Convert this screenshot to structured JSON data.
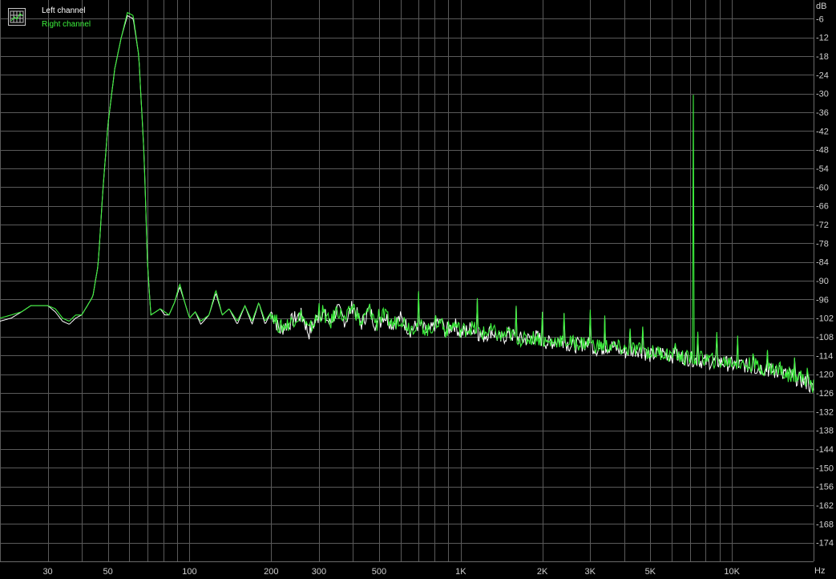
{
  "chart_data": {
    "type": "line",
    "xscale": "log",
    "xlim": [
      20,
      20000
    ],
    "ylim": [
      -180,
      0
    ],
    "xlabel": "Hz",
    "ylabel": "dB",
    "grid": true,
    "legend_placement": "top-left",
    "x_ticks": [
      {
        "value": 30,
        "label": "30"
      },
      {
        "value": 50,
        "label": "50"
      },
      {
        "value": 100,
        "label": "100"
      },
      {
        "value": 200,
        "label": "200"
      },
      {
        "value": 300,
        "label": "300"
      },
      {
        "value": 500,
        "label": "500"
      },
      {
        "value": 1000,
        "label": "1K"
      },
      {
        "value": 2000,
        "label": "2K"
      },
      {
        "value": 3000,
        "label": "3K"
      },
      {
        "value": 5000,
        "label": "5K"
      },
      {
        "value": 10000,
        "label": "10K"
      }
    ],
    "y_ticks": [
      -6,
      -12,
      -18,
      -24,
      -30,
      -36,
      -42,
      -48,
      -54,
      -60,
      -66,
      -72,
      -78,
      -84,
      -90,
      -96,
      -102,
      -108,
      -114,
      -120,
      -126,
      -132,
      -138,
      -144,
      -150,
      -156,
      -162,
      -168,
      -174
    ],
    "y_tick_labels": [
      "-6",
      "-12",
      "-18",
      "-24",
      "-30",
      "-36",
      "-42",
      "-48",
      "-54",
      "-60",
      "-66",
      "-72",
      "-78",
      "-84",
      "-90",
      "-96",
      "-102",
      "-108",
      "-114",
      "-120",
      "-126",
      "-132",
      "-138",
      "-144",
      "-150",
      "-156",
      "-162",
      "-168",
      "-174"
    ],
    "series": [
      {
        "name": "Left channel",
        "color": "#ffffff",
        "points": [
          [
            20,
            -103
          ],
          [
            22,
            -102
          ],
          [
            24,
            -100
          ],
          [
            26,
            -98
          ],
          [
            28,
            -98
          ],
          [
            30,
            -98
          ],
          [
            32,
            -100
          ],
          [
            34,
            -103
          ],
          [
            36,
            -104
          ],
          [
            38,
            -102
          ],
          [
            40,
            -101
          ],
          [
            42,
            -98
          ],
          [
            44,
            -95
          ],
          [
            46,
            -85
          ],
          [
            48,
            -60
          ],
          [
            50,
            -40
          ],
          [
            53,
            -22
          ],
          [
            56,
            -12
          ],
          [
            59,
            -5
          ],
          [
            62,
            -6
          ],
          [
            65,
            -18
          ],
          [
            68,
            -50
          ],
          [
            70,
            -85
          ],
          [
            72,
            -101
          ],
          [
            75,
            -100
          ],
          [
            78,
            -99
          ],
          [
            81,
            -101
          ],
          [
            84,
            -101
          ],
          [
            88,
            -97
          ],
          [
            92,
            -92
          ],
          [
            96,
            -97
          ],
          [
            100,
            -102
          ],
          [
            105,
            -100
          ],
          [
            110,
            -104
          ],
          [
            118,
            -101
          ],
          [
            125,
            -94
          ],
          [
            132,
            -101
          ],
          [
            140,
            -99
          ],
          [
            150,
            -104
          ],
          [
            160,
            -98
          ],
          [
            170,
            -104
          ],
          [
            180,
            -97
          ],
          [
            190,
            -104
          ],
          [
            200,
            -100
          ],
          [
            215,
            -106
          ],
          [
            230,
            -104
          ],
          [
            245,
            -102
          ],
          [
            260,
            -101
          ],
          [
            275,
            -107
          ],
          [
            290,
            -103
          ],
          [
            310,
            -100
          ],
          [
            330,
            -104
          ],
          [
            350,
            -99
          ],
          [
            375,
            -103
          ],
          [
            400,
            -98
          ],
          [
            430,
            -104
          ],
          [
            460,
            -99
          ],
          [
            490,
            -105
          ],
          [
            520,
            -101
          ],
          [
            560,
            -104
          ],
          [
            600,
            -102
          ],
          [
            650,
            -106
          ],
          [
            700,
            -104
          ],
          [
            760,
            -107
          ],
          [
            820,
            -103
          ],
          [
            880,
            -106
          ],
          [
            950,
            -104
          ],
          [
            1000,
            -107
          ],
          [
            1100,
            -105
          ],
          [
            1200,
            -108
          ],
          [
            1300,
            -106
          ],
          [
            1400,
            -109
          ],
          [
            1500,
            -107
          ],
          [
            1700,
            -109
          ],
          [
            1900,
            -108
          ],
          [
            2100,
            -110
          ],
          [
            2300,
            -109
          ],
          [
            2600,
            -111
          ],
          [
            2900,
            -110
          ],
          [
            3200,
            -112
          ],
          [
            3600,
            -111
          ],
          [
            4000,
            -113
          ],
          [
            4500,
            -112
          ],
          [
            5000,
            -114
          ],
          [
            5500,
            -113
          ],
          [
            6000,
            -114
          ],
          [
            7000,
            -115
          ],
          [
            8000,
            -116
          ],
          [
            9000,
            -116
          ],
          [
            10000,
            -117
          ],
          [
            11000,
            -117
          ],
          [
            12000,
            -118
          ],
          [
            13000,
            -118
          ],
          [
            14000,
            -119
          ],
          [
            15000,
            -120
          ],
          [
            16000,
            -120
          ],
          [
            17000,
            -121
          ],
          [
            18000,
            -122
          ],
          [
            19000,
            -123
          ],
          [
            20000,
            -125
          ]
        ],
        "spikes": [
          [
            300,
            -97
          ],
          [
            500,
            -95
          ],
          [
            700,
            -90
          ],
          [
            850,
            -98
          ],
          [
            1150,
            -94
          ],
          [
            1600,
            -97
          ],
          [
            2000,
            -100
          ],
          [
            2400,
            -96
          ],
          [
            3000,
            -97
          ],
          [
            3400,
            -99
          ],
          [
            4200,
            -100
          ],
          [
            4700,
            -99
          ],
          [
            6200,
            -106
          ],
          [
            7500,
            -104
          ],
          [
            8800,
            -107
          ],
          [
            10500,
            -108
          ],
          [
            12000,
            -109
          ],
          [
            13500,
            -110
          ],
          [
            15000,
            -112
          ],
          [
            17000,
            -113
          ],
          [
            19000,
            -115
          ]
        ]
      },
      {
        "name": "Right channel",
        "color": "#3cf03c",
        "points": [
          [
            20,
            -102
          ],
          [
            22,
            -101
          ],
          [
            24,
            -100
          ],
          [
            26,
            -98
          ],
          [
            28,
            -98
          ],
          [
            30,
            -98
          ],
          [
            32,
            -99
          ],
          [
            34,
            -102
          ],
          [
            36,
            -103
          ],
          [
            38,
            -101
          ],
          [
            40,
            -101
          ],
          [
            42,
            -98
          ],
          [
            44,
            -95
          ],
          [
            46,
            -85
          ],
          [
            48,
            -60
          ],
          [
            50,
            -40
          ],
          [
            53,
            -22
          ],
          [
            56,
            -12
          ],
          [
            59,
            -4
          ],
          [
            62,
            -5
          ],
          [
            65,
            -18
          ],
          [
            68,
            -50
          ],
          [
            70,
            -85
          ],
          [
            72,
            -101
          ],
          [
            75,
            -100
          ],
          [
            78,
            -99
          ],
          [
            81,
            -100
          ],
          [
            84,
            -101
          ],
          [
            88,
            -97
          ],
          [
            92,
            -91
          ],
          [
            96,
            -97
          ],
          [
            100,
            -102
          ],
          [
            105,
            -100
          ],
          [
            110,
            -103
          ],
          [
            118,
            -101
          ],
          [
            125,
            -93
          ],
          [
            132,
            -101
          ],
          [
            140,
            -99
          ],
          [
            150,
            -103
          ],
          [
            160,
            -98
          ],
          [
            170,
            -103
          ],
          [
            180,
            -97
          ],
          [
            190,
            -103
          ],
          [
            200,
            -100
          ],
          [
            215,
            -105
          ],
          [
            230,
            -104
          ],
          [
            245,
            -102
          ],
          [
            260,
            -101
          ],
          [
            275,
            -106
          ],
          [
            290,
            -103
          ],
          [
            310,
            -100
          ],
          [
            330,
            -104
          ],
          [
            350,
            -99
          ],
          [
            375,
            -103
          ],
          [
            400,
            -98
          ],
          [
            430,
            -104
          ],
          [
            460,
            -99
          ],
          [
            490,
            -104
          ],
          [
            520,
            -101
          ],
          [
            560,
            -104
          ],
          [
            600,
            -102
          ],
          [
            650,
            -105
          ],
          [
            700,
            -104
          ],
          [
            760,
            -106
          ],
          [
            820,
            -103
          ],
          [
            880,
            -106
          ],
          [
            950,
            -104
          ],
          [
            1000,
            -106
          ],
          [
            1100,
            -105
          ],
          [
            1200,
            -107
          ],
          [
            1300,
            -106
          ],
          [
            1400,
            -108
          ],
          [
            1500,
            -107
          ],
          [
            1700,
            -109
          ],
          [
            1900,
            -108
          ],
          [
            2100,
            -110
          ],
          [
            2300,
            -109
          ],
          [
            2600,
            -110
          ],
          [
            2900,
            -110
          ],
          [
            3200,
            -111
          ],
          [
            3600,
            -111
          ],
          [
            4000,
            -112
          ],
          [
            4500,
            -112
          ],
          [
            5000,
            -113
          ],
          [
            5500,
            -113
          ],
          [
            6000,
            -114
          ],
          [
            7000,
            -115
          ],
          [
            8000,
            -115
          ],
          [
            9000,
            -116
          ],
          [
            10000,
            -116
          ],
          [
            11000,
            -117
          ],
          [
            12000,
            -117
          ],
          [
            13000,
            -118
          ],
          [
            14000,
            -118
          ],
          [
            15000,
            -119
          ],
          [
            16000,
            -120
          ],
          [
            17000,
            -120
          ],
          [
            18000,
            -121
          ],
          [
            19000,
            -122
          ],
          [
            20000,
            -124
          ]
        ],
        "spikes": [
          [
            300,
            -96
          ],
          [
            500,
            -95
          ],
          [
            700,
            -89
          ],
          [
            850,
            -98
          ],
          [
            1150,
            -94
          ],
          [
            1600,
            -97
          ],
          [
            2000,
            -100
          ],
          [
            2400,
            -96
          ],
          [
            3000,
            -96
          ],
          [
            3400,
            -99
          ],
          [
            4200,
            -100
          ],
          [
            4700,
            -99
          ],
          [
            6200,
            -105
          ],
          [
            7200,
            -16
          ],
          [
            7500,
            -103
          ],
          [
            8800,
            -106
          ],
          [
            10500,
            -107
          ],
          [
            12000,
            -108
          ],
          [
            13500,
            -110
          ],
          [
            15000,
            -111
          ],
          [
            17000,
            -113
          ],
          [
            19000,
            -115
          ]
        ]
      }
    ]
  }
}
